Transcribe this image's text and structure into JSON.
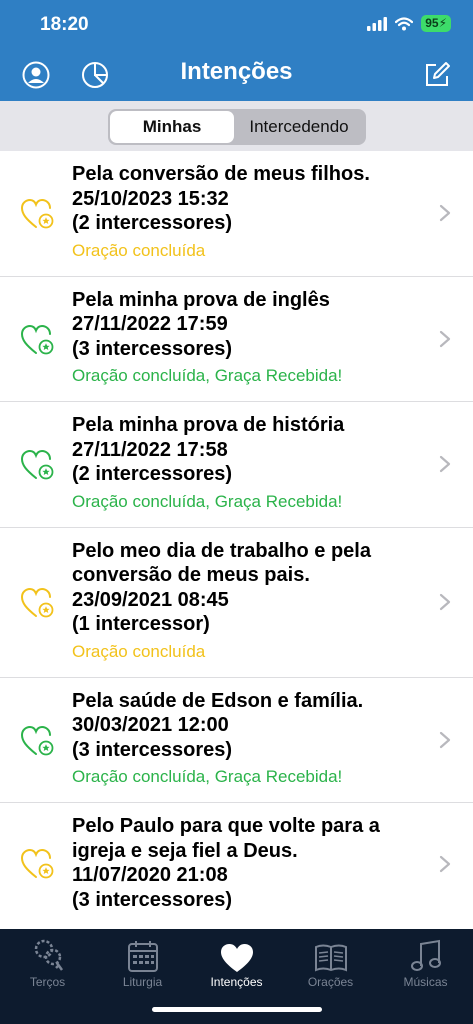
{
  "status_bar": {
    "time": "18:20",
    "battery": "95"
  },
  "nav": {
    "title": "Intenções"
  },
  "segments": [
    {
      "label": "Minhas",
      "active": true
    },
    {
      "label": "Intercedendo",
      "active": false
    }
  ],
  "intentions": [
    {
      "lines": [
        "Pela conversão de meus filhos.",
        "25/10/2023 15:32",
        "(2 intercessores)"
      ],
      "status": "Oração concluída",
      "state": "yellow"
    },
    {
      "lines": [
        "Pela minha prova de inglês",
        "27/11/2022 17:59",
        "(3 intercessores)"
      ],
      "status": "Oração concluída, Graça Recebida!",
      "state": "green"
    },
    {
      "lines": [
        "Pela minha prova de história",
        "27/11/2022 17:58",
        "(2 intercessores)"
      ],
      "status": "Oração concluída, Graça Recebida!",
      "state": "green"
    },
    {
      "lines": [
        "Pelo meo dia de trabalho e pela",
        "conversão de meus pais.",
        "23/09/2021 08:45",
        "(1 intercessor)"
      ],
      "status": "Oração concluída",
      "state": "yellow"
    },
    {
      "lines": [
        "Pela saúde de Edson e família.",
        "30/03/2021 12:00",
        "(3 intercessores)"
      ],
      "status": "Oração concluída, Graça Recebida!",
      "state": "green"
    },
    {
      "lines": [
        "Pelo Paulo para que volte para a",
        "igreja e seja fiel a Deus.",
        "11/07/2020 21:08",
        "(3 intercessores)"
      ],
      "status": "",
      "state": "yellow"
    }
  ],
  "colors": {
    "yellow": "#f2c21b",
    "green": "#2bb34a",
    "header": "#2f7fc4",
    "tabbar": "#0d1b2e"
  },
  "tabs": [
    {
      "label": "Terços",
      "icon": "rosary-icon",
      "active": false
    },
    {
      "label": "Liturgia",
      "icon": "calendar-icon",
      "active": false
    },
    {
      "label": "Intenções",
      "icon": "heart-icon",
      "active": true
    },
    {
      "label": "Orações",
      "icon": "prayer-book-icon",
      "active": false
    },
    {
      "label": "Músicas",
      "icon": "music-note-icon",
      "active": false
    }
  ]
}
